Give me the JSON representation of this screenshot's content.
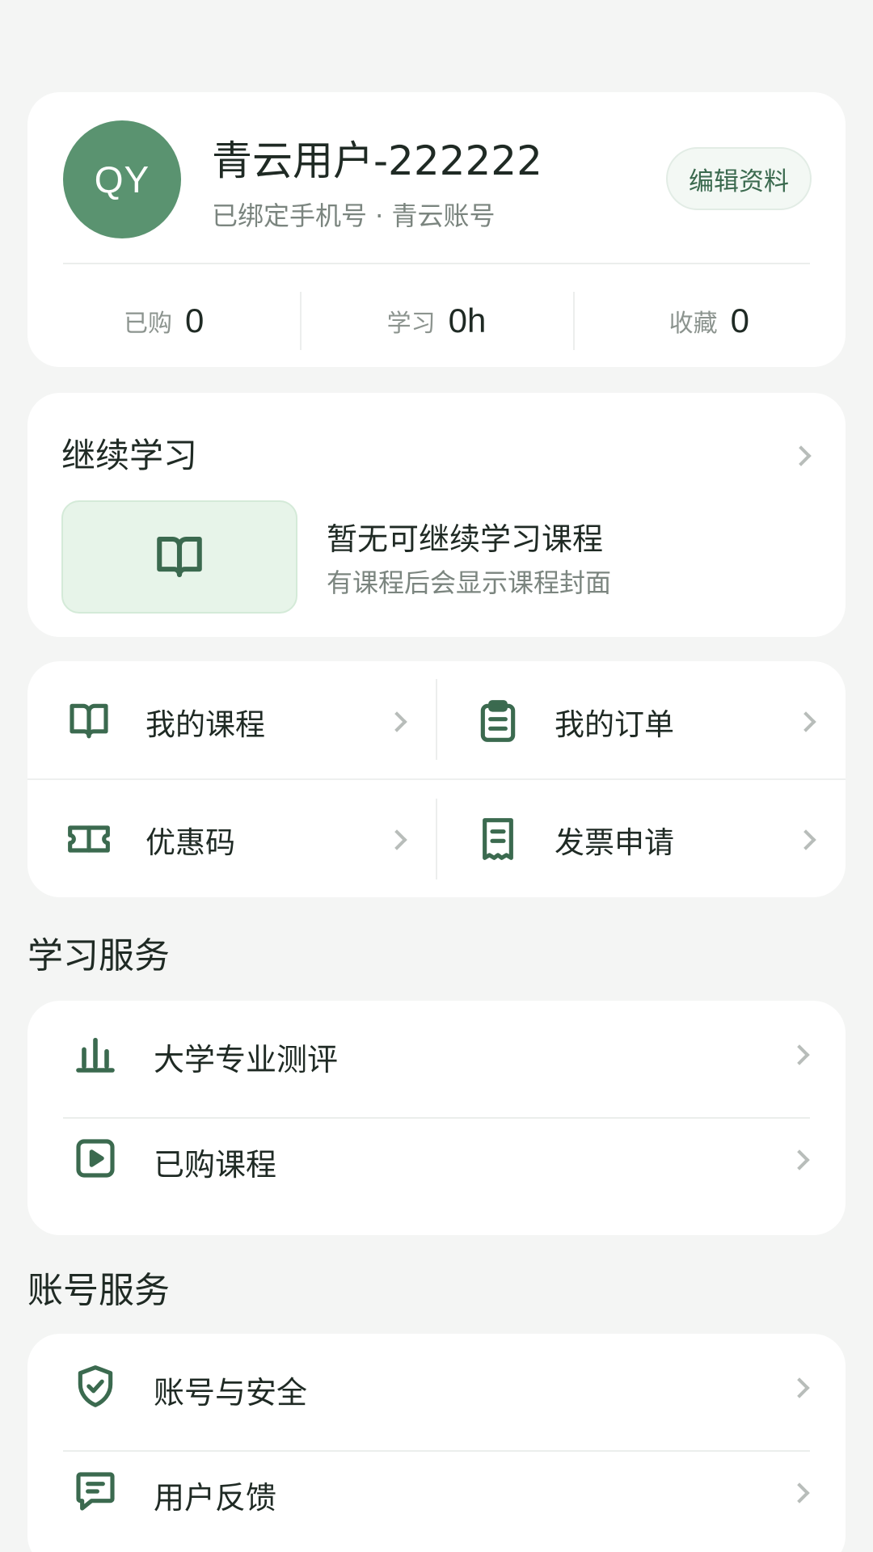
{
  "profile": {
    "avatar_initials": "QY",
    "name": "青云用户-222222",
    "subtitle": "已绑定手机号 · 青云账号",
    "edit_label": "编辑资料",
    "stats": [
      {
        "label": "已购",
        "value": "0"
      },
      {
        "label": "学习",
        "value": "0h"
      },
      {
        "label": "收藏",
        "value": "0"
      }
    ]
  },
  "continue_learning": {
    "title": "继续学习",
    "empty_title": "暂无可继续学习课程",
    "empty_subtitle": "有课程后会显示课程封面",
    "thumb_icon": "book-icon"
  },
  "grid_menu": [
    {
      "label": "我的课程",
      "icon": "book-icon"
    },
    {
      "label": "我的订单",
      "icon": "clipboard-icon"
    },
    {
      "label": "优惠码",
      "icon": "ticket-icon"
    },
    {
      "label": "发票申请",
      "icon": "receipt-icon"
    }
  ],
  "study_services": {
    "title": "学习服务",
    "items": [
      {
        "label": "大学专业测评",
        "icon": "chart-icon"
      },
      {
        "label": "已购课程",
        "icon": "play-icon"
      }
    ]
  },
  "account_services": {
    "title": "账号服务",
    "items": [
      {
        "label": "账号与安全",
        "icon": "shield-icon"
      },
      {
        "label": "用户反馈",
        "icon": "feedback-icon"
      }
    ]
  },
  "colors": {
    "accent": "#3b6a4f",
    "avatar_bg": "#5a9370",
    "background": "#f4f5f4",
    "card": "#ffffff"
  }
}
